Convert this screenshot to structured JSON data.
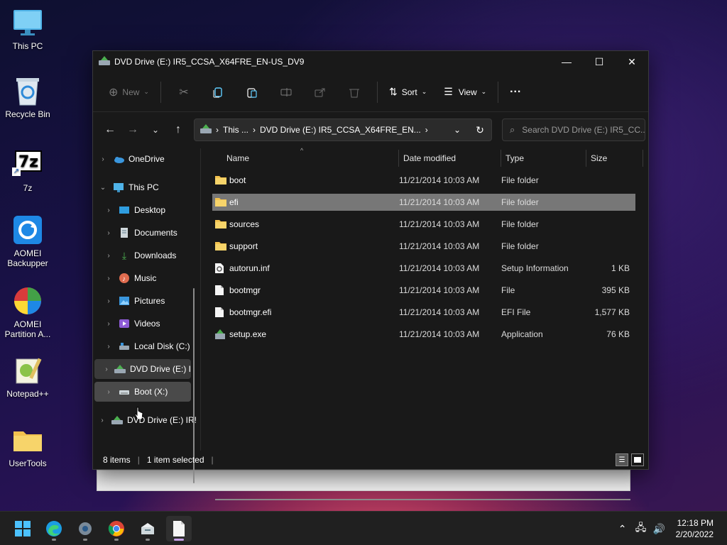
{
  "desktop": {
    "icons": [
      {
        "label": "This PC",
        "icon": "monitor-icon"
      },
      {
        "label": "Recycle Bin",
        "icon": "recycle-bin-icon"
      },
      {
        "label": "7z",
        "icon": "7zip-icon",
        "glyph": "7z"
      },
      {
        "label": "AOMEI Backupper",
        "icon": "aomei-backupper-icon"
      },
      {
        "label": "AOMEI Partition A...",
        "icon": "aomei-partition-icon"
      },
      {
        "label": "Notepad++",
        "icon": "notepad-plus-icon"
      },
      {
        "label": "UserTools",
        "icon": "folder-icon"
      }
    ]
  },
  "window": {
    "title": "DVD Drive (E:) IR5_CCSA_X64FRE_EN-US_DV9",
    "controls": {
      "minimize": "—",
      "maximize": "☐",
      "close": "✕"
    }
  },
  "toolbar": {
    "new_label": "New",
    "sort_label": "Sort",
    "view_label": "View",
    "more_label": "···"
  },
  "address": {
    "crumbs": [
      "This ...",
      "DVD Drive (E:) IR5_CCSA_X64FRE_EN..."
    ],
    "search_placeholder": "Search DVD Drive (E:) IR5_CC..."
  },
  "nav": {
    "items": [
      {
        "label": "OneDrive",
        "icon": "cloud-icon",
        "level": 0
      },
      {
        "label": "This PC",
        "icon": "monitor-icon",
        "level": 0,
        "expanded": true
      },
      {
        "label": "Desktop",
        "icon": "desktop-icon",
        "level": 1
      },
      {
        "label": "Documents",
        "icon": "documents-icon",
        "level": 1
      },
      {
        "label": "Downloads",
        "icon": "download-icon",
        "level": 1
      },
      {
        "label": "Music",
        "icon": "music-icon",
        "level": 1
      },
      {
        "label": "Pictures",
        "icon": "pictures-icon",
        "level": 1
      },
      {
        "label": "Videos",
        "icon": "videos-icon",
        "level": 1
      },
      {
        "label": "Local Disk (C:)",
        "icon": "disk-icon",
        "level": 1
      },
      {
        "label": "DVD Drive (E:) I",
        "icon": "dvd-icon",
        "level": 1,
        "selected": true
      },
      {
        "label": "Boot (X:)",
        "icon": "drive-icon",
        "level": 1,
        "hover": true
      },
      {
        "label": "DVD Drive (E:) IR!",
        "icon": "dvd-icon",
        "level": 0
      }
    ]
  },
  "columns": {
    "name": "Name",
    "date": "Date modified",
    "type": "Type",
    "size": "Size"
  },
  "files": [
    {
      "name": "boot",
      "date": "11/21/2014 10:03 AM",
      "type": "File folder",
      "size": "",
      "icon": "folder-icon"
    },
    {
      "name": "efi",
      "date": "11/21/2014 10:03 AM",
      "type": "File folder",
      "size": "",
      "icon": "folder-icon",
      "selected": true
    },
    {
      "name": "sources",
      "date": "11/21/2014 10:03 AM",
      "type": "File folder",
      "size": "",
      "icon": "folder-icon"
    },
    {
      "name": "support",
      "date": "11/21/2014 10:03 AM",
      "type": "File folder",
      "size": "",
      "icon": "folder-icon"
    },
    {
      "name": "autorun.inf",
      "date": "11/21/2014 10:03 AM",
      "type": "Setup Information",
      "size": "1 KB",
      "icon": "settings-file-icon"
    },
    {
      "name": "bootmgr",
      "date": "11/21/2014 10:03 AM",
      "type": "File",
      "size": "395 KB",
      "icon": "file-icon"
    },
    {
      "name": "bootmgr.efi",
      "date": "11/21/2014 10:03 AM",
      "type": "EFI File",
      "size": "1,577 KB",
      "icon": "file-icon"
    },
    {
      "name": "setup.exe",
      "date": "11/21/2014 10:03 AM",
      "type": "Application",
      "size": "76 KB",
      "icon": "setup-icon"
    }
  ],
  "status": {
    "count": "8 items",
    "selection": "1 item selected"
  },
  "taskbar": {
    "apps": [
      "start-icon",
      "edge-icon",
      "settings-icon",
      "chrome-icon",
      "installer-icon",
      "notepad-icon"
    ],
    "clock_time": "12:18 PM",
    "clock_date": "2/20/2022"
  },
  "colors": {
    "accent": "#60cdff",
    "folder": "#f2c14e",
    "selection": "#777777"
  }
}
